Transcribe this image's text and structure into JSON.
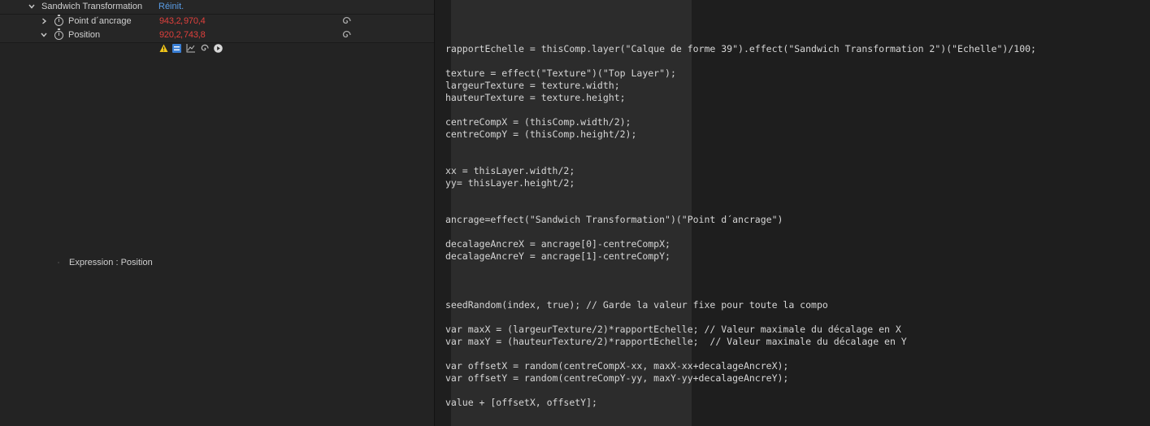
{
  "effect": {
    "name": "Sandwich Transformation",
    "reset_label": "Réinit."
  },
  "properties": [
    {
      "name": "Point d´ancrage",
      "value_x": "943,2",
      "value_y": "970,4",
      "expanded": false
    },
    {
      "name": "Position",
      "value_x": "920,2",
      "value_y": "743,8",
      "expanded": true
    }
  ],
  "expression": {
    "label": "Expression : Position",
    "tools": [
      "warning-icon",
      "equals-toggle-icon",
      "graph-icon",
      "pick-whip-icon",
      "language-menu-icon"
    ],
    "code": "rapportEchelle = thisComp.layer(\"Calque de forme 39\").effect(\"Sandwich Transformation 2\")(\"Echelle\")/100;\n\ntexture = effect(\"Texture\")(\"Top Layer\");\nlargeurTexture = texture.width;\nhauteurTexture = texture.height;\n\ncentreCompX = (thisComp.width/2);\ncentreCompY = (thisComp.height/2);\n\n\nxx = thisLayer.width/2;\nyy= thisLayer.height/2;\n\n\nancrage=effect(\"Sandwich Transformation\")(\"Point d´ancrage\")\n\ndecalageAncreX = ancrage[0]-centreCompX;\ndecalageAncreY = ancrage[1]-centreCompY;\n\n\n\nseedRandom(index, true); // Garde la valeur fixe pour toute la compo\n\nvar maxX = (largeurTexture/2)*rapportEchelle; // Valeur maximale du décalage en X\nvar maxY = (hauteurTexture/2)*rapportEchelle;  // Valeur maximale du décalage en Y\n\nvar offsetX = random(centreCompX-xx, maxX-xx+decalageAncreX);\nvar offsetY = random(centreCompY-yy, maxY-yy+decalageAncreY);\n\nvalue + [offsetX, offsetY];"
  },
  "colors": {
    "value_red": "#e0403c",
    "reset_blue": "#5a9de6",
    "warning_yellow": "#f0c419",
    "toggle_blue": "#3a7fd5"
  }
}
